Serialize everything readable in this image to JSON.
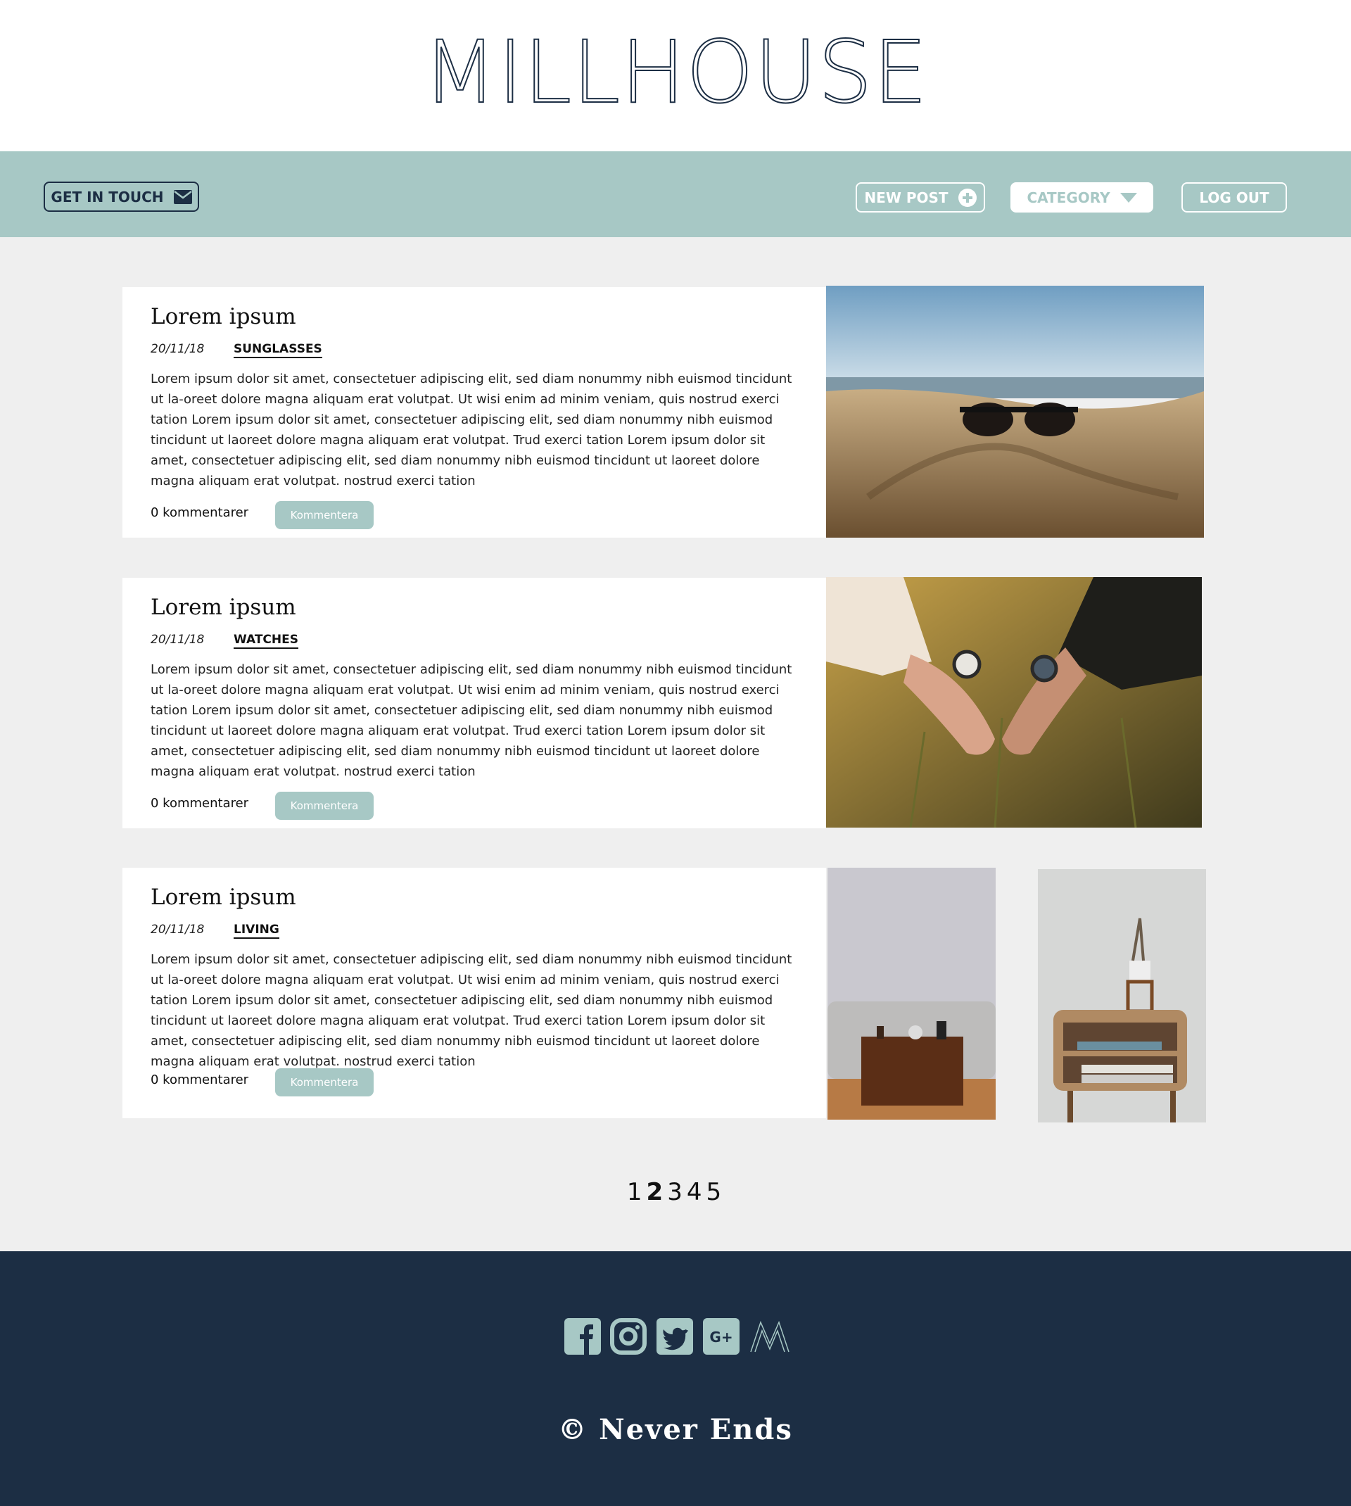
{
  "header": {
    "logo": "MILLHOUSE"
  },
  "nav": {
    "contact_label": "GET IN TOUCH",
    "new_post_label": "NEW POST",
    "category_label": "CATEGORY",
    "logout_label": "LOG OUT"
  },
  "posts": [
    {
      "title": "Lorem ipsum",
      "date": "20/11/18",
      "category": "SUNGLASSES",
      "body": "Lorem ipsum dolor sit amet, consectetuer adipiscing elit, sed diam nonummy nibh euismod tincidunt ut la-oreet dolore magna aliquam erat volutpat. Ut wisi enim ad minim veniam, quis nostrud exerci tation Lorem ipsum dolor sit amet, consectetuer adipiscing elit, sed diam nonummy nibh euismod tincidunt ut laoreet dolore magna aliquam erat volutpat. Trud exerci tation  Lorem ipsum dolor sit amet, consectetuer adipiscing elit, sed diam nonummy nibh euismod tincidunt ut laoreet dolore magna aliquam erat volutpat. nostrud exerci tation",
      "comments": "0 kommentarer",
      "comment_button": "Kommentera"
    },
    {
      "title": "Lorem ipsum",
      "date": "20/11/18",
      "category": "WATCHES",
      "body": "Lorem ipsum dolor sit amet, consectetuer adipiscing elit, sed diam nonummy nibh euismod tincidunt ut la-oreet dolore magna aliquam erat volutpat. Ut wisi enim ad minim veniam, quis nostrud exerci tation Lorem ipsum dolor sit amet, consectetuer adipiscing elit, sed diam nonummy nibh euismod tincidunt ut laoreet dolore magna aliquam erat volutpat. Trud exerci tation  Lorem ipsum dolor sit amet, consectetuer adipiscing elit, sed diam nonummy nibh euismod tincidunt ut laoreet dolore magna aliquam erat volutpat. nostrud exerci tation",
      "comments": "0 kommentarer",
      "comment_button": "Kommentera"
    },
    {
      "title": "Lorem ipsum",
      "date": "20/11/18",
      "category": "LIVING",
      "body": "Lorem ipsum dolor sit amet, consectetuer adipiscing elit, sed diam nonummy nibh euismod tincidunt ut la-oreet dolore magna aliquam erat volutpat. Ut wisi enim ad minim veniam, quis nostrud exerci tation Lorem ipsum dolor sit amet, consectetuer adipiscing elit, sed diam nonummy nibh euismod tincidunt ut laoreet dolore magna aliquam erat volutpat. Trud exerci tation  Lorem ipsum dolor sit amet, consectetuer adipiscing elit, sed diam nonummy nibh euismod tincidunt ut laoreet dolore magna aliquam erat volutpat. nostrud exerci tation",
      "comments": "0 kommentarer",
      "comment_button": "Kommentera"
    }
  ],
  "pagination": {
    "pages": [
      "1",
      "2",
      "3",
      "4",
      "5"
    ],
    "current": "2"
  },
  "footer": {
    "social_icons": [
      "facebook-icon",
      "instagram-icon",
      "twitter-icon",
      "google-plus-icon",
      "millhouse-logo-icon"
    ],
    "copyright": "© Never Ends"
  },
  "colors": {
    "accent": "#a7c8c5",
    "navy": "#1c2e44",
    "background": "#efefef"
  }
}
